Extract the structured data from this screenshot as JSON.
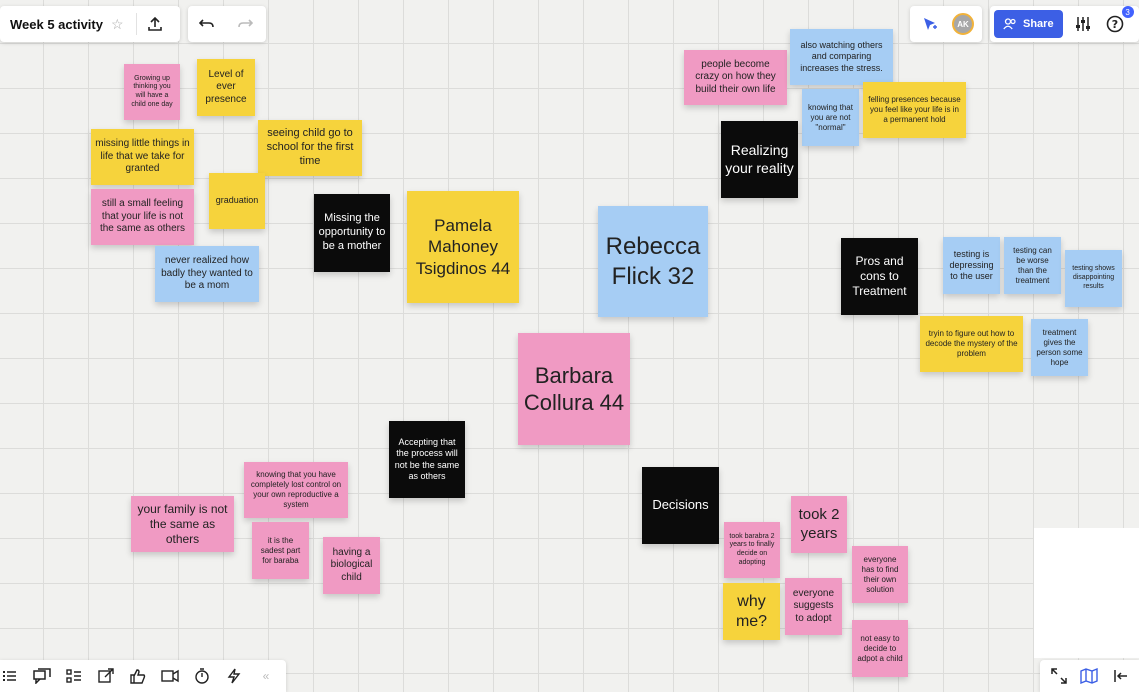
{
  "board": {
    "title": "Week 5 activity"
  },
  "top_right": {
    "avatar_initials": "AK",
    "share_label": "Share",
    "help_badge": "3"
  },
  "notes": {
    "growing_up": "Growing up thinking you will have a child one day",
    "level_presence": "Level of ever presence",
    "missing_little": "missing little things in life that we take for granted",
    "seeing_child": "seeing child go to school for the first time",
    "graduation": "graduation",
    "small_feeling": "still a small feeling that your life is not the same as others",
    "never_realized": "never realized how badly they wanted to be a mom",
    "missing_opportunity": "Missing the opportunity to be a mother",
    "pamela": "Pamela Mahoney Tsigdinos 44",
    "rebecca": "Rebecca Flick 32",
    "barbara": "Barbara Collura 44",
    "people_crazy": "people become crazy on how they build their own life",
    "watching_others": "also watching others and comparing increases the stress.",
    "knowing_not_normal": "knowing that you are not \"normal\"",
    "felling_presences": "felling presences because you feel like your life is in a permanent hold",
    "realizing": "Realizing your reality",
    "pros_cons": "Pros and cons to Treatment",
    "testing_depressing": "testing is depressing to the user",
    "testing_worse": "testing can be worse than the treatment",
    "testing_shows": "testing shows disappointing results",
    "tryin_decode": "tryin to figure out how to decode the mystery of the problem",
    "treatment_hope": "treatment gives the person some hope",
    "accepting": "Accepting that the process will not be the same as others",
    "lost_control": "knowing that you have completely lost control on your own reproductive a system",
    "family_not_same": "your family is not the same as others",
    "saddest_part": "it is the sadest part for baraba",
    "biological": "having a biological child",
    "decisions": "Decisions",
    "took_2_years": "took 2 years",
    "took_barabra": "took barabra 2 years to finally decide on adopting",
    "find_own": "everyone has to find their own solution",
    "why_me": "why me?",
    "suggests_adopt": "everyone suggests to adopt",
    "not_easy": "not easy to decide to adpot a child"
  }
}
